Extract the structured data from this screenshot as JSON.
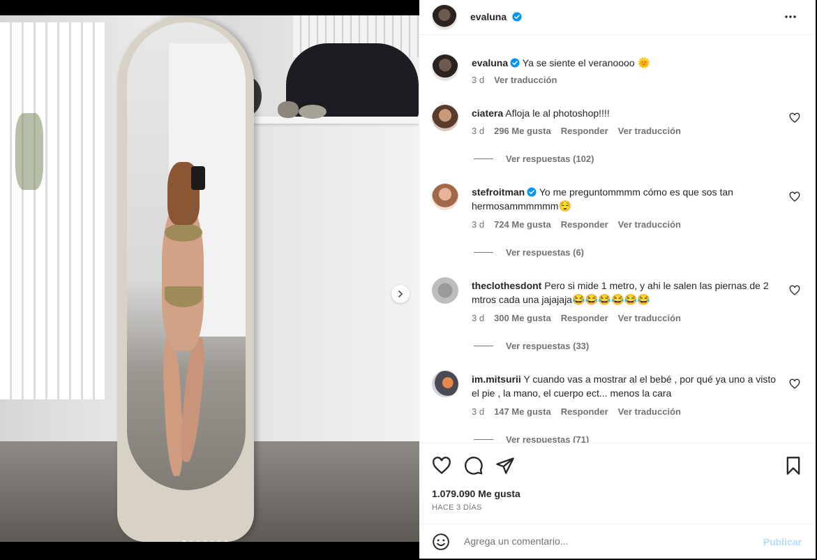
{
  "post": {
    "username": "evaluna",
    "verified": true,
    "caption": "Ya se siente el veranoooo",
    "caption_emoji": "🌞",
    "caption_time": "3 d",
    "caption_translate": "Ver traducción",
    "image_dots": 7,
    "active_dot": 0
  },
  "comments": [
    {
      "user": "ciatera",
      "verified": false,
      "text": "Afloja le al photoshop!!!!",
      "time": "3 d",
      "likes": "296 Me gusta",
      "reply": "Responder",
      "translate": "Ver traducción",
      "replies": "Ver respuestas (102)"
    },
    {
      "user": "stefroitman",
      "verified": true,
      "text": "Yo me preguntommmm cómo es que sos tan hermosammmmmm",
      "emoji": "😌",
      "time": "3 d",
      "likes": "724 Me gusta",
      "reply": "Responder",
      "translate": "Ver traducción",
      "replies": "Ver respuestas (6)"
    },
    {
      "user": "theclothesdont",
      "verified": false,
      "text": "Pero si mide 1 metro, y ahi le salen las piernas de 2 mtros cada una jajajaja",
      "emoji": "😂😂😂😂😂😂",
      "time": "3 d",
      "likes": "300 Me gusta",
      "reply": "Responder",
      "translate": "Ver traducción",
      "replies": "Ver respuestas (33)"
    },
    {
      "user": "im.mitsurii",
      "verified": false,
      "text": "Y cuando vas a mostrar al el bebé , por qué ya uno a visto el pie , la mano, el cuerpo ect... menos la cara",
      "time": "3 d",
      "likes": "147 Me gusta",
      "reply": "Responder",
      "translate": "Ver traducción",
      "replies": "Ver respuestas (71)"
    }
  ],
  "footer": {
    "likes": "1.079.090 Me gusta",
    "posted": "HACE 3 DÍAS",
    "comment_placeholder": "Agrega un comentario...",
    "publish": "Publicar"
  },
  "colors": {
    "verified": "#0095f6",
    "publish_disabled": "#b3dbff",
    "secondary_text": "#737373"
  },
  "icons": [
    "more-options-icon",
    "verified-icon",
    "heart-icon",
    "comment-icon",
    "share-icon",
    "bookmark-icon",
    "emoji-icon",
    "chevron-right-icon"
  ]
}
